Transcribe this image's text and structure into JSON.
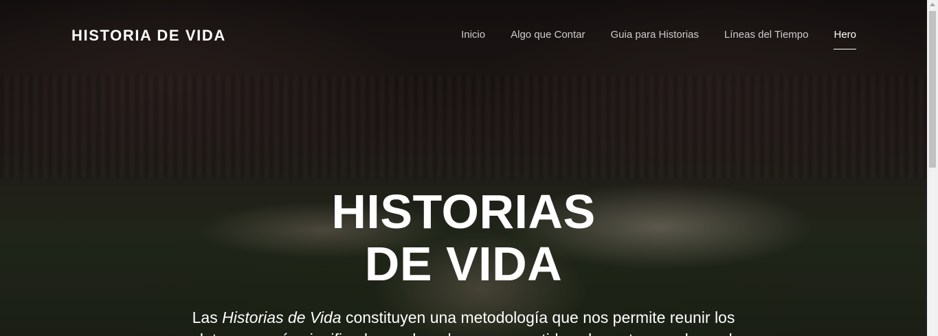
{
  "header": {
    "brand": "HISTORIA DE VIDA",
    "nav": [
      {
        "label": "Inicio"
      },
      {
        "label": "Algo que Contar"
      },
      {
        "label": "Guia para Historias"
      },
      {
        "label": "Líneas del Tiempo"
      },
      {
        "label": "Hero",
        "active": true
      }
    ]
  },
  "hero": {
    "title_line1": "HISTORIAS",
    "title_line2": "DE VIDA",
    "lead_prefix": "Las ",
    "lead_emphasis": "Historias de Vida",
    "lead_suffix": " constituyen una metodología que nos permite reunir los",
    "lead_line2": "relatos con más significado y ordenarlos en un sentido coherente con el mundo"
  },
  "colors": {
    "text": "#ffffff",
    "nav_inactive": "#c9c6c4",
    "background_dark": "#1a1614",
    "scrollbar_track": "#f1f1f1",
    "scrollbar_thumb": "#c1c1c1"
  }
}
